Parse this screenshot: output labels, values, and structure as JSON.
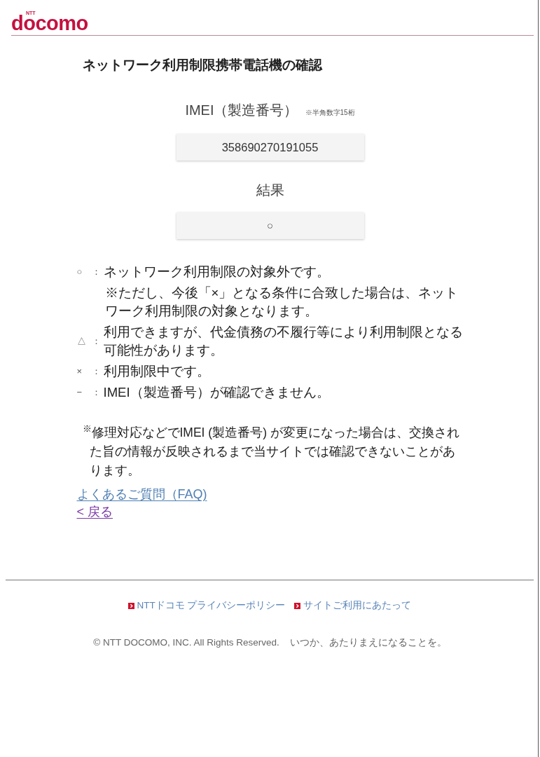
{
  "header": {
    "logo": {
      "small": "NTT",
      "main": "docomo"
    }
  },
  "page_title": "ネットワーク利用制限携帯電話機の確認",
  "imei_field": {
    "label": "IMEI（製造番号）",
    "note": "※半角数字15桁",
    "value": "358690270191055"
  },
  "result_field": {
    "label": "結果",
    "value": "○"
  },
  "legend": [
    {
      "symbol": "○",
      "separator": "：",
      "text": "ネットワーク利用制限の対象外です。",
      "note": "※ただし、今後「×」となる条件に合致した場合は、ネットワーク利用制限の対象となります。"
    },
    {
      "symbol": "△",
      "separator": "：",
      "text": "利用できますが、代金債務の不履行等により利用制限となる可能性があります。"
    },
    {
      "symbol": "×",
      "separator": "：",
      "text": "利用制限中です。"
    },
    {
      "symbol": "−",
      "separator": "：",
      "text": "IMEI（製造番号）が確認できません。"
    }
  ],
  "notice": "$^{※}$修理対応などでIMEI (製造番号) が変更になった場合は、交換された旨の情報が反映されるまで当サイトでは確認できないことがあります。",
  "links": [
    {
      "label": "よくあるご質問（FAQ)",
      "visited": false
    },
    {
      "label": "< 戻る",
      "visited": true
    }
  ],
  "footer": {
    "links": [
      "NTTドコモ プライバシーポリシー",
      "サイトご利用にあたって"
    ],
    "copyright": "© NTT DOCOMO, INC. All Rights Reserved.",
    "tagline": "いつか、あたりまえになることを。"
  }
}
